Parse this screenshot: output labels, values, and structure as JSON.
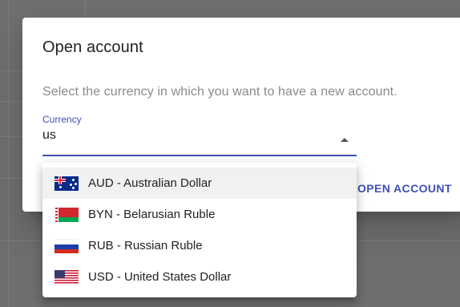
{
  "dialog": {
    "title": "Open account",
    "description": "Select the currency in which you want to have a new account.",
    "currency_field": {
      "label": "Currency",
      "value": "us"
    },
    "open_button_label": "OPEN ACCOUNT"
  },
  "dropdown": {
    "options": [
      {
        "label": "AUD - Australian Dollar",
        "flag": "australia-flag-icon"
      },
      {
        "label": "BYN - Belarusian Ruble",
        "flag": "belarus-flag-icon"
      },
      {
        "label": "RUB - Russian Ruble",
        "flag": "russia-flag-icon"
      },
      {
        "label": "USD - United States Dollar",
        "flag": "usa-flag-icon"
      }
    ]
  },
  "colors": {
    "primary": "#3f51b5",
    "overlay": "#6e6e6e"
  }
}
